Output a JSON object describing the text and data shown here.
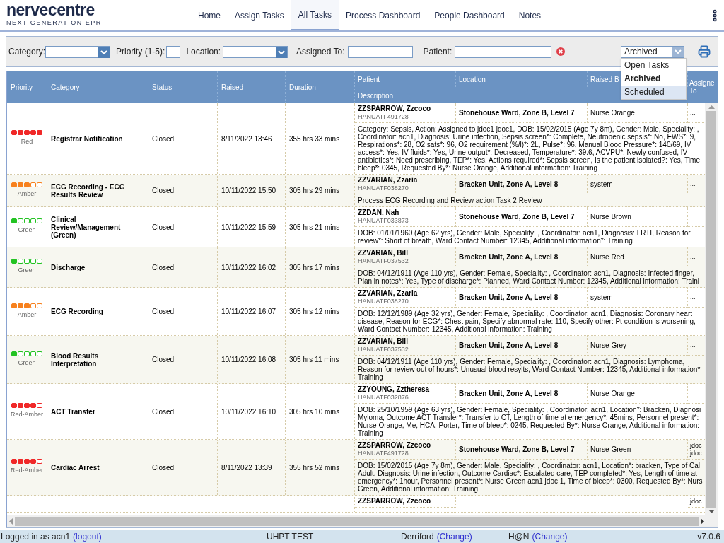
{
  "header": {
    "logo": "nervecentre",
    "tagline": "NEXT GENERATION EPR"
  },
  "nav": [
    {
      "label": "Home",
      "selected": false
    },
    {
      "label": "Assign Tasks",
      "selected": false
    },
    {
      "label": "All Tasks",
      "selected": true
    },
    {
      "label": "Process Dashboard",
      "selected": false
    },
    {
      "label": "People Dashboard",
      "selected": false
    },
    {
      "label": "Notes",
      "selected": false
    }
  ],
  "filters": {
    "category_label": "Category:",
    "priority_label": "Priority (1-5):",
    "location_label": "Location:",
    "assigned_label": "Assigned To:",
    "patient_label": "Patient:",
    "view": {
      "value": "Archived",
      "expanded": true,
      "options": [
        {
          "label": "Open Tasks",
          "selected": false,
          "highlighted": false
        },
        {
          "label": "Archived",
          "selected": true,
          "highlighted": false
        },
        {
          "label": "Scheduled",
          "selected": false,
          "highlighted": true
        }
      ]
    }
  },
  "table": {
    "columns": [
      "Priority",
      "Category",
      "Status",
      "Raised",
      "Duration",
      "Patient",
      "Description",
      "Location",
      "Raised B",
      "Assigne To"
    ],
    "rows": [
      {
        "priority_label": "Red",
        "stars": 5,
        "color": "#f02828",
        "category": "Registrar Notification",
        "status": "Closed",
        "raised": "8/11/2022 13:46",
        "duration": "355 hrs 33 mins",
        "patient": "ZZSPARROW, Zzcoco",
        "patient_id": "HANUATF491728",
        "location": "Stonehouse Ward, Zone B, Level 7",
        "raised_by": "Nurse Orange",
        "assigned": [
          "..."
        ],
        "description": "Category: Sepsis, Action: Assigned to jdoc1 jdoc1, DOB: 15/02/2015 (Age 7y 8m), Gender: Male, Speciality: , Coordinator: acn1, Diagnosis: Urine infection, Sepsis screen*: Complete, Neutropenic sepsis*: No, EWS*: 9, Respirations*: 28, O2 sats*: 96, O2 requirement (%/l)*: 2L, Pulse*: 96, Manual Blood Pressure*: 140/69, IV access*: Yes, IV fluids*: Yes, Urine output*: Decreased, Temperature*: 39.6, ACVPU*: Newly confused, IV antibiotics*: Need prescribing, TEP*: Yes, Actions required*: Sepsis screen, Is the patient isolated?: Yes, Time bleep*: 0345, Requested By*: Nurse Orange, Additional information: Training"
      },
      {
        "priority_label": "Amber",
        "stars": 3,
        "color": "#f7811e",
        "category": "ECG Recording - ECG Results Review",
        "status": "Closed",
        "raised": "10/11/2022 15:50",
        "duration": "305 hrs 29 mins",
        "patient": "ZZVARIAN, Zzaria",
        "patient_id": "HANUATF038270",
        "location": "Bracken Unit, Zone A, Level 8",
        "raised_by": "system",
        "assigned": [
          "..."
        ],
        "description": "Process ECG Recording and Review action Task 2 Review"
      },
      {
        "priority_label": "Green",
        "stars": 1,
        "color": "#22c322",
        "category": "Clinical Review/Management (Green)",
        "status": "Closed",
        "raised": "10/11/2022 15:59",
        "duration": "305 hrs 21 mins",
        "patient": "ZZDAN, Nah",
        "patient_id": "HANUATF033873",
        "location": "Stonehouse Ward, Zone B, Level 7",
        "raised_by": "Nurse Brown",
        "assigned": [
          "..."
        ],
        "description": "DOB: 01/01/1960 (Age 62 yrs), Gender: Male, Speciality: , Coordinator: acn1, Diagnosis: LRTI, Reason for review*: Short of breath, Ward Contact Number: 12345, Additional information*: Training"
      },
      {
        "priority_label": "Green",
        "stars": 1,
        "color": "#22c322",
        "category": "Discharge",
        "status": "Closed",
        "raised": "10/11/2022 16:02",
        "duration": "305 hrs 17 mins",
        "patient": "ZZVARIAN, Bill",
        "patient_id": "HANUATF037532",
        "location": "Bracken Unit, Zone A, Level 8",
        "raised_by": "Nurse Red",
        "assigned": [
          "..."
        ],
        "description": "DOB: 04/12/1911 (Age 110 yrs), Gender: Female, Speciality: , Coordinator: acn1, Diagnosis: Infected finger, Plan in notes*: Yes, Type of discharge*: Planned, Ward Contact Number: 12345, Additional information: Traini"
      },
      {
        "priority_label": "Amber",
        "stars": 3,
        "color": "#f7811e",
        "category": "ECG Recording",
        "status": "Closed",
        "raised": "10/11/2022 16:07",
        "duration": "305 hrs 12 mins",
        "patient": "ZZVARIAN, Zzaria",
        "patient_id": "HANUATF038270",
        "location": "Bracken Unit, Zone A, Level 8",
        "raised_by": "system",
        "assigned": [
          "..."
        ],
        "description": "DOB: 12/12/1989 (Age 32 yrs), Gender: Female, Speciality: , Coordinator: acn1, Diagnosis: Coronary heart disease, Reason for ECG*: Chest pain, Specify abnormal rate: 110, Specify other: Pt condition is worsening, Ward Contact Number: 12345, Additional information: Training"
      },
      {
        "priority_label": "Green",
        "stars": 1,
        "color": "#22c322",
        "category": "Blood Results Interpretation",
        "status": "Closed",
        "raised": "10/11/2022 16:08",
        "duration": "305 hrs 11 mins",
        "patient": "ZZVARIAN, Bill",
        "patient_id": "HANUATF037532",
        "location": "Bracken Unit, Zone A, Level 8",
        "raised_by": "Nurse Grey",
        "assigned": [
          "..."
        ],
        "description": "DOB: 04/12/1911 (Age 110 yrs), Gender: Female, Speciality: , Coordinator: acn1, Diagnosis: Lymphoma, Reason for review out of hours*: Unusual blood resylts, Ward Contact Number: 12345, Additional information* Training"
      },
      {
        "priority_label": "Red-Amber",
        "stars": 4,
        "color": "#f02828",
        "category": "ACT Transfer",
        "status": "Closed",
        "raised": "10/11/2022 16:10",
        "duration": "305 hrs 10 mins",
        "patient": "ZZYOUNG, Zztheresa",
        "patient_id": "HANUATF032876",
        "location": "Bracken Unit, Zone A, Level 8",
        "raised_by": "Nurse Orange",
        "assigned": [
          "..."
        ],
        "description": "DOB: 25/10/1959 (Age 63 yrs), Gender: Female, Speciality: , Coordinator: acn1, Location*: Bracken, Diagnosi Myloma, Outcome ACT Transfer*: Transfer to CT, Length of time at emergency*: 45mins, Personnel present*: Nurse Orange, Me, HCA, Porter, Time of bleep*: 0245, Requested By*: Nurse Orange, Additional information: Training"
      },
      {
        "priority_label": "Red-Amber",
        "stars": 4,
        "color": "#f02828",
        "category": "Cardiac Arrest",
        "status": "Closed",
        "raised": "8/11/2022 13:39",
        "duration": "355 hrs 52 mins",
        "patient": "ZZSPARROW, Zzcoco",
        "patient_id": "HANUATF491728",
        "location": "Stonehouse Ward, Zone B, Level 7",
        "raised_by": "Nurse Green",
        "assigned": [
          "jdoc",
          "jdoc"
        ],
        "description": "DOB: 15/02/2015 (Age 7y 8m), Gender: Male, Speciality: , Coordinator: acn1, Location*: bracken, Type of Cal Adult, Diagnosis: Urine infection, Outcome Cardiac*: Escalated care, TEP completed*: Yes, Length of time at emergency*: 1hour, Personnel present*: Nurse Green acn1 jdoc 1, Time of bleep*: 0300, Requested By*: Nurs Green, Additional information: Training"
      },
      {
        "patient": "ZZSPARROW, Zzcoco",
        "assigned": [
          "jdoc"
        ]
      }
    ]
  },
  "status_bar": {
    "user": "Logged in as acn1",
    "logout": "(logout)",
    "environment": "UHPT TEST",
    "site": "Derriford",
    "site_change": "(Change)",
    "unit": "H@N",
    "unit_change": "(Change)",
    "version": "v7.0.6"
  }
}
